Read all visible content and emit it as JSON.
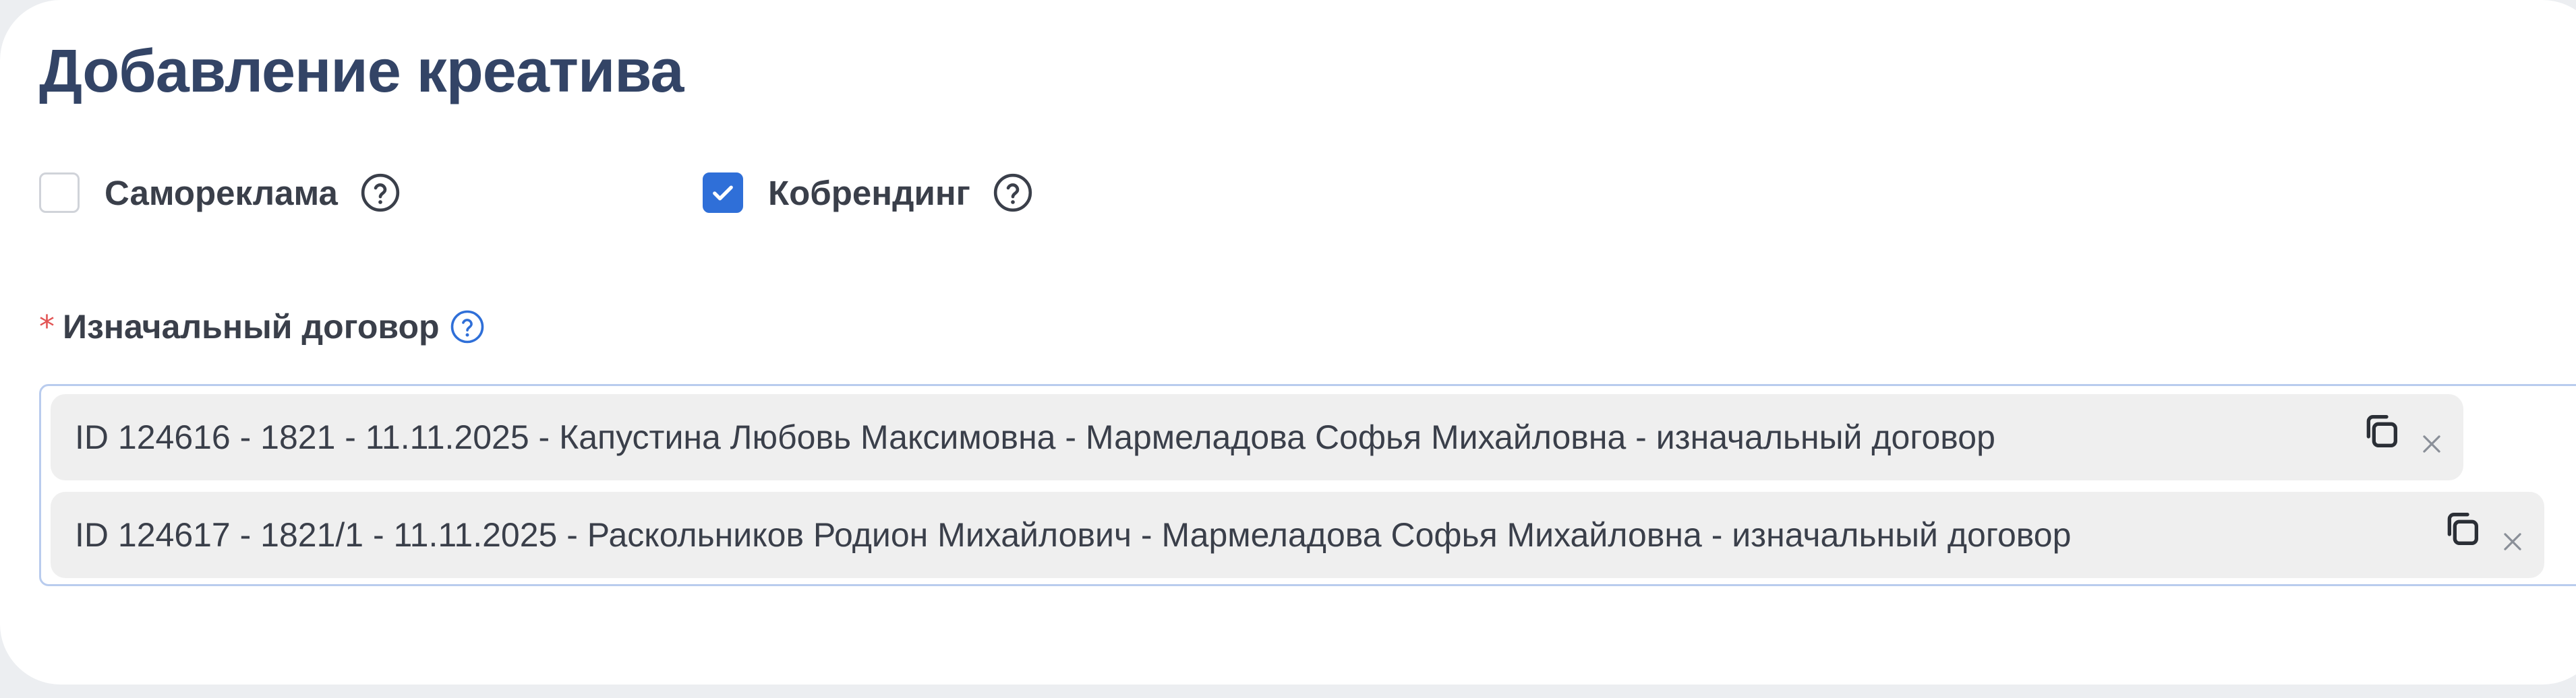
{
  "form": {
    "title": "Добавление креатива",
    "checkboxes": [
      {
        "label": "Самореклама",
        "checked": false,
        "icon": "help-circle-icon"
      },
      {
        "label": "Кобрендинг",
        "checked": true,
        "icon": "help-circle-icon"
      }
    ],
    "contract_field": {
      "required_mark": "*",
      "label": "Изначальный договор",
      "icon": "help-circle-icon",
      "selected": [
        {
          "text": "ID 124616 - 1821 - 11.11.2025 - Капустина Любовь Максимовна - Мармеладова Софья Михайловна - изначальный договор",
          "icons": [
            "copy-icon",
            "close-icon"
          ]
        },
        {
          "text": "ID 124617 - 1821/1 - 11.11.2025 - Раскольников Родион Михайлович - Мармеладова Софья Михайловна - изначальный договор",
          "icons": [
            "copy-icon",
            "close-icon"
          ]
        }
      ]
    }
  },
  "colors": {
    "accent": "#2f6fd8",
    "title": "#334466",
    "text": "#3a3f4a",
    "required": "#e25454",
    "tag_bg": "#efefef",
    "input_border": "#b9ccee",
    "page_bg": "#eceef1"
  }
}
